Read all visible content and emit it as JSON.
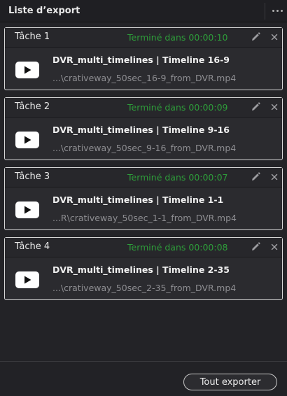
{
  "header": {
    "title": "Liste d’export",
    "menu_icon": "more-horizontal-icon"
  },
  "jobs": [
    {
      "name": "Tâche 1",
      "status": "Terminé dans 00:00:10",
      "title": "DVR_multi_timelines | Timeline 16-9",
      "path": "...\\crativeway_50sec_16-9_from_DVR.mp4"
    },
    {
      "name": "Tâche 2",
      "status": "Terminé dans 00:00:09",
      "title": "DVR_multi_timelines | Timeline 9-16",
      "path": "...\\crativeway_50sec_9-16_from_DVR.mp4"
    },
    {
      "name": "Tâche 3",
      "status": "Terminé dans 00:00:07",
      "title": "DVR_multi_timelines | Timeline 1-1",
      "path": "...R\\crativeway_50sec_1-1_from_DVR.mp4"
    },
    {
      "name": "Tâche 4",
      "status": "Terminé dans 00:00:08",
      "title": "DVR_multi_timelines | Timeline 2-35",
      "path": "...\\crativeway_50sec_2-35_from_DVR.mp4"
    }
  ],
  "footer": {
    "export_all_label": "Tout exporter"
  },
  "colors": {
    "status_done": "#2e9e3a",
    "panel_bg": "#232327",
    "card_border": "#d6d6d6"
  }
}
